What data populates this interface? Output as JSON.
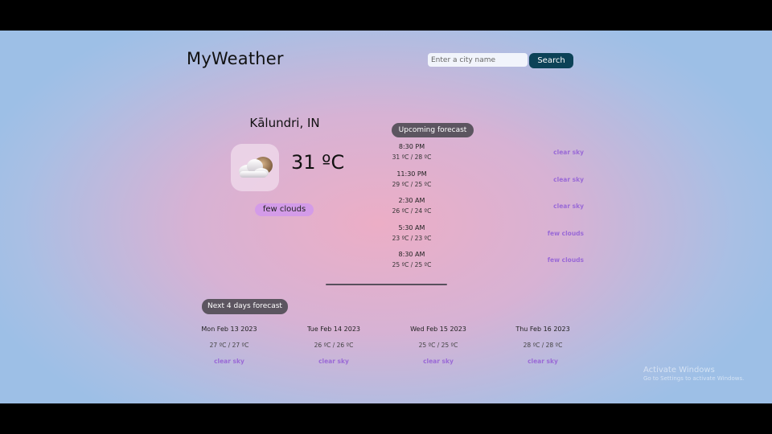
{
  "header": {
    "brand": "MyWeather"
  },
  "search": {
    "placeholder": "Enter a city name",
    "button_label": "Search"
  },
  "current": {
    "city": "Kālundri, IN",
    "temperature": "31 ºC",
    "condition": "few clouds",
    "icon": "few-clouds-icon"
  },
  "upcoming": {
    "title": "Upcoming forecast",
    "items": [
      {
        "time": "8:30 PM",
        "range": "31 ºC / 28 ºC",
        "desc": "clear sky"
      },
      {
        "time": "11:30 PM",
        "range": "29 ºC / 25 ºC",
        "desc": "clear sky"
      },
      {
        "time": "2:30 AM",
        "range": "26 ºC / 24 ºC",
        "desc": "clear sky"
      },
      {
        "time": "5:30 AM",
        "range": "23 ºC / 23 ºC",
        "desc": "few clouds"
      },
      {
        "time": "8:30 AM",
        "range": "25 ºC / 25 ºC",
        "desc": "few clouds"
      }
    ]
  },
  "next_days": {
    "title": "Next 4 days forecast",
    "days": [
      {
        "date": "Mon Feb 13 2023",
        "range": "27 ºC / 27 ºC",
        "desc": "clear sky"
      },
      {
        "date": "Tue Feb 14 2023",
        "range": "26 ºC / 26 ºC",
        "desc": "clear sky"
      },
      {
        "date": "Wed Feb 15 2023",
        "range": "25 ºC / 25 ºC",
        "desc": "clear sky"
      },
      {
        "date": "Thu Feb 16 2023",
        "range": "28 ºC / 28 ºC",
        "desc": "clear sky"
      }
    ]
  },
  "watermark": {
    "title": "Activate Windows",
    "subtitle": "Go to Settings to activate Windows."
  },
  "colors": {
    "accent_dark": "#0c4257",
    "pill": "#5c5560",
    "condition_text": "#9a6ad6",
    "condition_pill": "#d39be8"
  }
}
